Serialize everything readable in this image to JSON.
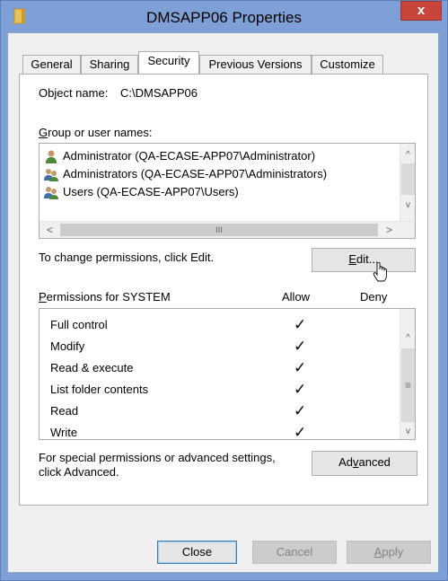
{
  "window": {
    "title": "DMSAPP06 Properties",
    "close_label": "x"
  },
  "tabs": [
    {
      "label": "General"
    },
    {
      "label": "Sharing"
    },
    {
      "label": "Security"
    },
    {
      "label": "Previous Versions"
    },
    {
      "label": "Customize"
    }
  ],
  "security": {
    "object_name_label": "Object name:",
    "object_name_value": "C:\\DMSAPP06",
    "group_label_key": "G",
    "group_label_rest": "roup or user names:",
    "users": [
      {
        "name": "Administrator (QA-ECASE-APP07\\Administrator)",
        "icon": "single-user-icon"
      },
      {
        "name": "Administrators (QA-ECASE-APP07\\Administrators)",
        "icon": "user-group-icon"
      },
      {
        "name": "Users (QA-ECASE-APP07\\Users)",
        "icon": "user-group-icon"
      }
    ],
    "hscroll_left": "<",
    "hscroll_grip": "III",
    "hscroll_right": ">",
    "vscroll_up": "^",
    "vscroll_down": "v",
    "change_hint": "To change permissions, click Edit.",
    "edit_key": "E",
    "edit_rest": "dit...",
    "permissions_key": "P",
    "permissions_rest": "ermissions for SYSTEM",
    "allow_label": "Allow",
    "deny_label": "Deny",
    "permissions": [
      {
        "name": "Full control",
        "allow": "✓"
      },
      {
        "name": "Modify",
        "allow": "✓"
      },
      {
        "name": "Read & execute",
        "allow": "✓"
      },
      {
        "name": "List folder contents",
        "allow": "✓"
      },
      {
        "name": "Read",
        "allow": "✓"
      },
      {
        "name": "Write",
        "allow": "✓"
      }
    ],
    "perm_scroll_grip": "≡",
    "advanced_hint_line1": "For special permissions or advanced settings,",
    "advanced_hint_line2": "click Advanced.",
    "advanced_pre": "Ad",
    "advanced_key": "v",
    "advanced_post": "anced"
  },
  "footer": {
    "close_label": "Close",
    "cancel_label": "Cancel",
    "apply_key": "A",
    "apply_rest": "pply"
  },
  "colors": {
    "titlebar": "#7fa0d6",
    "close_button": "#c7453a",
    "dialog_bg": "#f0f0f0"
  }
}
